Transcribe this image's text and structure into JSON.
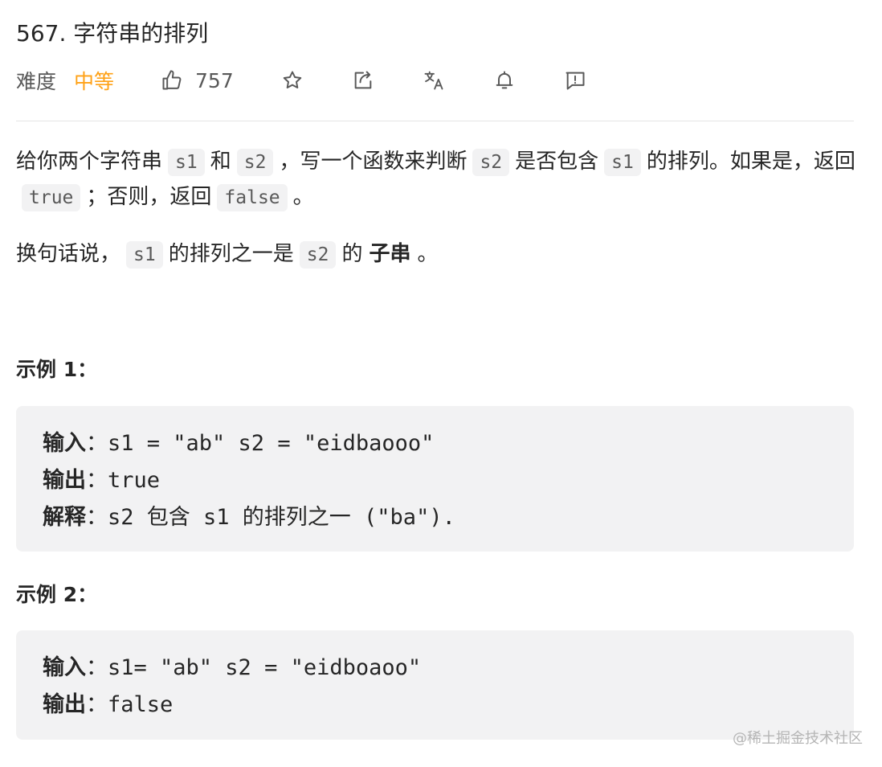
{
  "problem": {
    "title": "567. 字符串的排列",
    "difficulty_label": "难度",
    "difficulty_value": "中等",
    "likes": "757"
  },
  "icons": {
    "like": "thumbs-up-icon",
    "favorite": "star-icon",
    "share": "share-icon",
    "translate": "translate-icon",
    "notify": "bell-icon",
    "feedback": "feedback-icon"
  },
  "description": {
    "p1": {
      "t1": "给你两个字符串",
      "c1": "s1",
      "t2": "和",
      "c2": "s2",
      "t3": "，写一个函数来判断",
      "c3": "s2",
      "t4": "是否包含",
      "c4": "s1",
      "t5": "的排列。如果是，返回",
      "c5": "true",
      "t6": "；否则，返回",
      "c6": "false",
      "t7": "。"
    },
    "p2": {
      "t1": "换句话说，",
      "c1": "s1",
      "t2": "的排列之一是",
      "c2": "s2",
      "t3": "的",
      "strong": "子串",
      "t4": "。"
    }
  },
  "examples": [
    {
      "title": "示例 1：",
      "input_label": "输入",
      "input_value": "s1 = \"ab\" s2 = \"eidbaooo\"",
      "output_label": "输出",
      "output_value": "true",
      "explain_label": "解释",
      "explain_value": "s2 包含 s1 的排列之一 (\"ba\")."
    },
    {
      "title": "示例 2：",
      "input_label": "输入",
      "input_value": "s1= \"ab\" s2 = \"eidboaoo\"",
      "output_label": "输出",
      "output_value": "false"
    }
  ],
  "colon": "：",
  "watermark": "@稀土掘金技术社区",
  "colors": {
    "difficulty_medium": "#ffa116",
    "code_bg": "#f2f2f3",
    "text": "#262626"
  }
}
